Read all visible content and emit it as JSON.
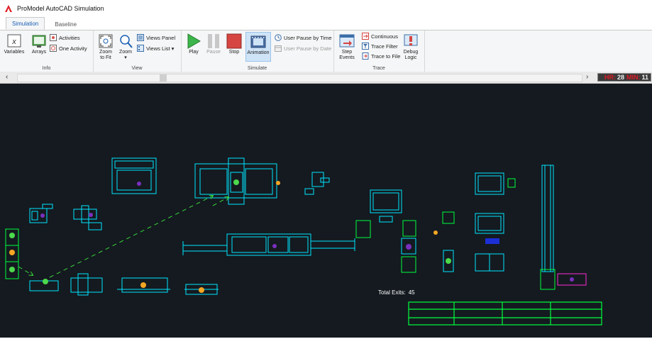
{
  "window": {
    "title": "ProModel AutoCAD Simulation"
  },
  "tabs": [
    {
      "label": "Simulation",
      "active": true
    },
    {
      "label": "Baseline",
      "active": false
    }
  ],
  "ribbon": {
    "info": {
      "label": "Info",
      "variables": "Variables",
      "arrays": "Arrays",
      "activities": "Activities",
      "one_activity": "One Activity"
    },
    "view": {
      "label": "View",
      "zoom_to_fit_1": "Zoom",
      "zoom_to_fit_2": "to Fit",
      "zoom": "Zoom",
      "views_panel": "Views Panel",
      "views_list": "Views List"
    },
    "simulate": {
      "label": "Simulate",
      "play": "Play",
      "pause": "Pause",
      "stop": "Stop",
      "animation": "Animation",
      "user_pause_time": "User Pause by Time",
      "user_pause_date": "User Pause by Date"
    },
    "trace": {
      "label": "Trace",
      "step_events_1": "Step",
      "step_events_2": "Events",
      "continuous": "Continuous",
      "trace_filter": "Trace Filter",
      "trace_to_file": "Trace to File",
      "debug_logic_1": "Debug",
      "debug_logic_2": "Logic"
    }
  },
  "clock": {
    "hr_label": "HR:",
    "hr_value": "28",
    "min_label": "MIN:",
    "min_value": "11"
  },
  "canvas": {
    "total_exits_label": "Total Exits:",
    "total_exits_value": "45"
  },
  "colors": {
    "canvas_bg": "#141a20",
    "cad_cyan": "#00e5ff",
    "cad_green": "#00ff3c",
    "path_arrows": "#3ad63a",
    "entity_green": "#4cd94c",
    "entity_orange": "#f5a623",
    "entity_purple": "#7b2fbe",
    "clock_label": "#e01b24"
  },
  "icons": {
    "app": "autocad-logo-icon",
    "play": "play-icon",
    "pause": "pause-icon",
    "stop": "stop-icon"
  }
}
